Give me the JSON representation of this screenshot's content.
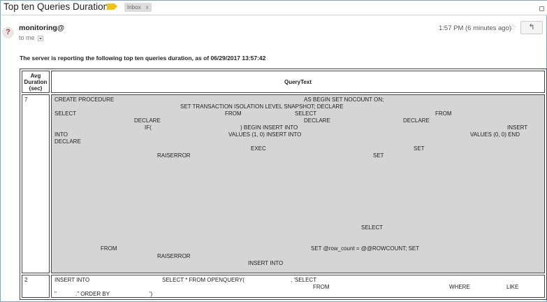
{
  "subject": "Top ten Queries Duration",
  "inbox_chip": "Inbox",
  "inbox_chip_close": "x",
  "sender": "monitoring@",
  "recipient": "to me",
  "timestamp": "1:57 PM (6 minutes ago)",
  "star_icon": "☆",
  "reply_icon": "↰",
  "intro": "The server is reporting the following top ten queries duration, as of 06/29/2017 13:57:42",
  "table": {
    "headers": [
      "Avg Duration (sec)",
      "QueryText"
    ],
    "rows": [
      {
        "duration": "7",
        "tokens": [
          "CREATE PROCEDURE",
          "AS BEGIN SET NOCOUNT ON;",
          "SET TRANSACTION ISOLATION LEVEL SNAPSHOT; DECLARE",
          "SELECT",
          "FROM",
          "SELECT",
          "FROM",
          "DECLARE",
          "DECLARE",
          "DECLARE",
          "IF(",
          ") BEGIN INSERT INTO",
          "INSERT",
          "INTO",
          "VALUES (1, 0) INSERT INTO",
          "VALUES (0, 0) END",
          "DECLARE",
          "EXEC",
          "SET",
          "RAISERROR",
          "SET",
          "SELECT",
          "FROM",
          "SET @row_count = @@ROWCOUNT; SET",
          "RAISERROR",
          "INSERT INTO"
        ]
      },
      {
        "duration": "2",
        "tokens": [
          "INSERT INTO",
          "SELECT * FROM OPENQUERY(",
          ", 'SELECT",
          "FROM",
          "WHERE",
          "LIKE",
          "\"",
          ".\" ORDER BY",
          "')"
        ]
      }
    ]
  },
  "colors": {
    "accent_border": "#7fa6c9",
    "label_tag": "#f1c40f",
    "query_cell_bg": "#d5d5d5"
  }
}
